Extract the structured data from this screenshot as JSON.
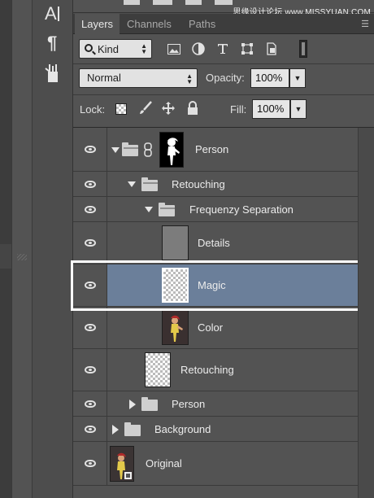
{
  "watermark": "思缘设计论坛 www.MISSYUAN.COM",
  "tabs": [
    {
      "label": "Layers",
      "active": true
    },
    {
      "label": "Channels",
      "active": false
    },
    {
      "label": "Paths",
      "active": false
    }
  ],
  "filter": {
    "kind_label": "Kind"
  },
  "blend": {
    "mode": "Normal",
    "opacity_label": "Opacity:",
    "opacity_value": "100%"
  },
  "lock": {
    "label": "Lock:",
    "fill_label": "Fill:",
    "fill_value": "100%"
  },
  "layers": [
    {
      "name": "Person",
      "type": "group",
      "expanded": true,
      "has_mask": true,
      "visible": true
    },
    {
      "name": "Retouching",
      "type": "group",
      "expanded": true,
      "visible": true
    },
    {
      "name": "Frequenzy Separation",
      "type": "group",
      "expanded": true,
      "visible": true
    },
    {
      "name": "Details",
      "type": "layer",
      "visible": true
    },
    {
      "name": "Magic",
      "type": "layer",
      "selected": true,
      "visible": true
    },
    {
      "name": "Color",
      "type": "layer",
      "visible": true
    },
    {
      "name": "Retouching",
      "type": "layer",
      "visible": true
    },
    {
      "name": "Person",
      "type": "group",
      "expanded": false,
      "visible": true
    },
    {
      "name": "Background",
      "type": "group",
      "expanded": false,
      "visible": true
    },
    {
      "name": "Original",
      "type": "layer",
      "visible": true
    }
  ],
  "colors": {
    "selected_row": "#6b7f9a",
    "panel_bg": "#535353",
    "highlight_frame": "#ffffff"
  }
}
